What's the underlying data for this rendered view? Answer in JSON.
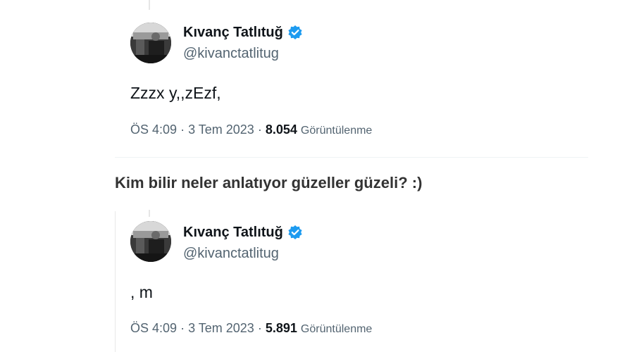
{
  "tweets": [
    {
      "display_name": "Kıvanç Tatlıtuğ",
      "handle": "@kivanctatlitug",
      "text": "Zzzx y,,zEzf,",
      "time": "ÖS 4:09",
      "date": "3 Tem 2023",
      "views_count": "8.054",
      "views_label": "Görüntülenme",
      "separator": "·"
    },
    {
      "display_name": "Kıvanç Tatlıtuğ",
      "handle": "@kivanctatlitug",
      "text": ", m",
      "time": "ÖS 4:09",
      "date": "3 Tem 2023",
      "views_count": "5.891",
      "views_label": "Görüntülenme",
      "separator": "·"
    }
  ],
  "caption": "Kim bilir neler anlatıyor güzeller güzeli? :)",
  "colors": {
    "verified_badge": "#1d9bf0",
    "secondary_text": "#536471",
    "primary_text": "#0f1419"
  },
  "icons": {
    "verified": "verified-badge-icon",
    "avatar": "profile-avatar"
  }
}
